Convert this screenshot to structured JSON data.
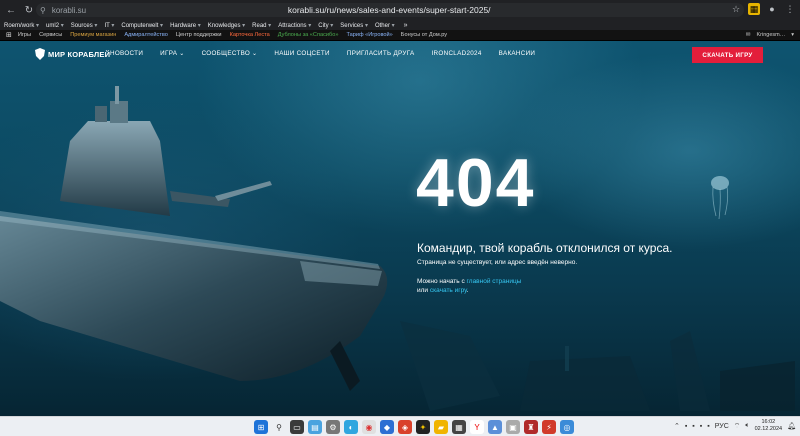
{
  "browser": {
    "short_url": "korabli.su",
    "full_url": "korabli.su/ru/news/sales-and-events/super-start-2025/",
    "bookmarks": [
      "Roem/work",
      "uml2",
      "Sources",
      "IT",
      "Computerwelt",
      "Hardware",
      "Knowledges",
      "Read",
      "Attractions",
      "City",
      "Services",
      "Other"
    ]
  },
  "portal_bar": {
    "items": [
      {
        "label": "Игры",
        "color": "default"
      },
      {
        "label": "Сервисы",
        "color": "default"
      },
      {
        "label": "Премиум магазин",
        "color": "gold"
      },
      {
        "label": "Адмиралтейство",
        "color": "lblue"
      },
      {
        "label": "Центр поддержки",
        "color": "default"
      },
      {
        "label": "Карточка Леста",
        "color": "red"
      },
      {
        "label": "Дублоны за «Спасибо»",
        "color": "green"
      },
      {
        "label": "Тариф «Игровой»",
        "color": "lblue"
      },
      {
        "label": "Бонусы от Дом.ру",
        "color": "default"
      }
    ],
    "username": "Kringesm…"
  },
  "site": {
    "brand": "МИР КОРАБЛЕЙ",
    "menu": [
      {
        "label": "НОВОСТИ",
        "dropdown": false
      },
      {
        "label": "ИГРА",
        "dropdown": true
      },
      {
        "label": "СООБЩЕСТВО",
        "dropdown": true
      },
      {
        "label": "НАШИ СОЦСЕТИ",
        "dropdown": false
      },
      {
        "label": "ПРИГЛАСИТЬ ДРУГА",
        "dropdown": false
      },
      {
        "label": "IRONCLAD2024",
        "dropdown": false
      },
      {
        "label": "ВАКАНСИИ",
        "dropdown": false
      }
    ],
    "cta_label": "СКАЧАТЬ ИГРУ",
    "cta_color": "#e31e3b",
    "link_color": "#36c6f0"
  },
  "error": {
    "code": "404",
    "title": "Командир, твой корабль отклонился от курса.",
    "subtitle": "Страница не существует, или адрес введён неверно.",
    "line1_prefix": "Можно начать с ",
    "line1_link": "главной страницы",
    "line2_prefix": "или ",
    "line2_link": "скачать игру",
    "line2_suffix": "."
  },
  "taskbar": {
    "lang": "РУС",
    "time": "16:02",
    "date": "02.12.2024"
  }
}
